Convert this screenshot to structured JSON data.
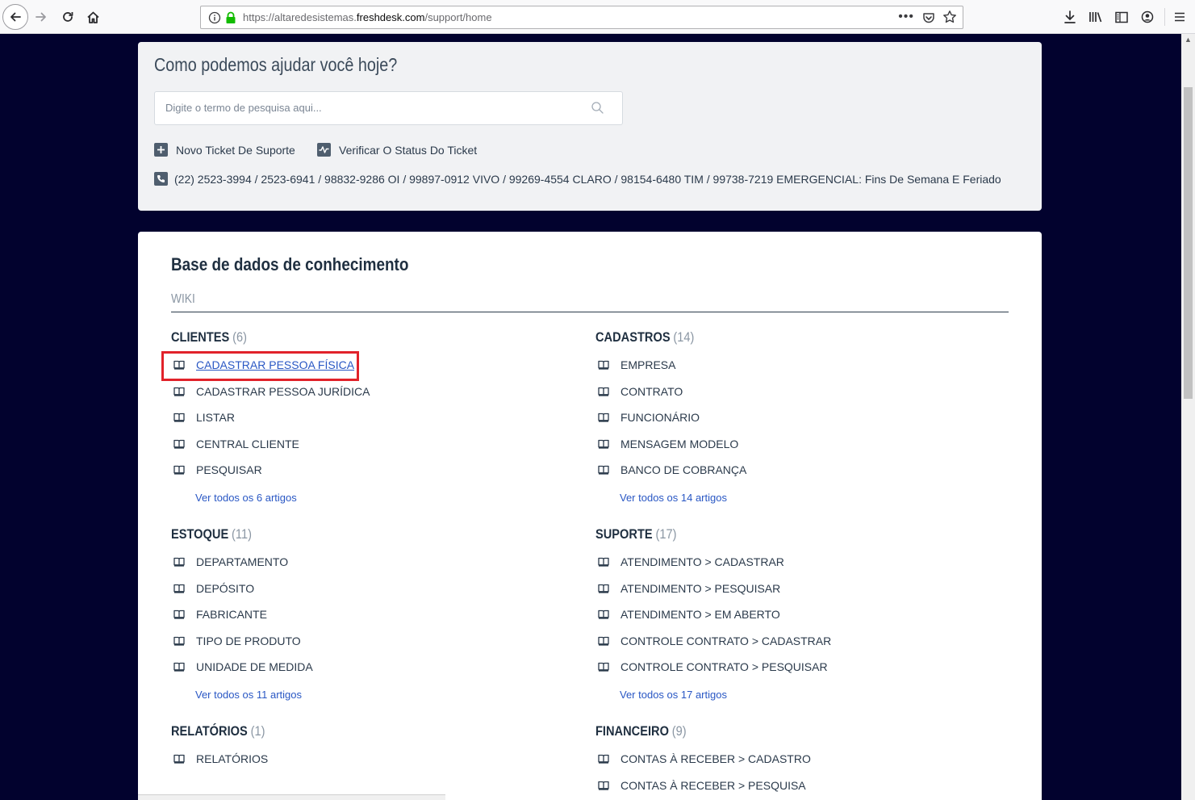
{
  "browser": {
    "url_prefix": "https://altaredesistemas.",
    "url_host": "freshdesk.com",
    "url_path": "/support/home",
    "more_label": "•••"
  },
  "search_card": {
    "title": "Como podemos ajudar você hoje?",
    "search_placeholder": "Digite o termo de pesquisa aqui...",
    "new_ticket_label": "Novo Ticket De Suporte",
    "check_status_label": "Verificar O Status Do Ticket",
    "phone_text": "(22) 2523-3994 / 2523-6941 / 98832-9286 OI / 99897-0912 VIVO / 99269-4554 CLARO / 98154-6480 TIM / 99738-7219 EMERGENCIAL: Fins De Semana E Feriado"
  },
  "knowledge_base": {
    "title": "Base de dados de conhecimento",
    "section": "WIKI",
    "categories": [
      {
        "name": "CLIENTES",
        "count": "(6)",
        "articles": [
          "CADASTRAR PESSOA FÍSICA",
          "CADASTRAR PESSOA JURÍDICA",
          "LISTAR",
          "CENTRAL CLIENTE",
          "PESQUISAR"
        ],
        "see_all": "Ver todos os 6 artigos"
      },
      {
        "name": "CADASTROS",
        "count": "(14)",
        "articles": [
          "EMPRESA",
          "CONTRATO",
          "FUNCIONÁRIO",
          "MENSAGEM MODELO",
          "BANCO DE COBRANÇA"
        ],
        "see_all": "Ver todos os 14 artigos"
      },
      {
        "name": "ESTOQUE",
        "count": "(11)",
        "articles": [
          "DEPARTAMENTO",
          "DEPÓSITO",
          "FABRICANTE",
          "TIPO DE PRODUTO",
          "UNIDADE DE MEDIDA"
        ],
        "see_all": "Ver todos os 11 artigos"
      },
      {
        "name": "SUPORTE",
        "count": "(17)",
        "articles": [
          "ATENDIMENTO > CADASTRAR",
          "ATENDIMENTO > PESQUISAR",
          "ATENDIMENTO > EM ABERTO",
          "CONTROLE CONTRATO > CADASTRAR",
          "CONTROLE CONTRATO > PESQUISAR"
        ],
        "see_all": "Ver todos os 17 artigos"
      },
      {
        "name": "RELATÓRIOS",
        "count": "(1)",
        "articles": [
          "RELATÓRIOS"
        ]
      },
      {
        "name": "FINANCEIRO",
        "count": "(9)",
        "articles": [
          "CONTAS À RECEBER > CADASTRO",
          "CONTAS À RECEBER > PESQUISA"
        ]
      }
    ]
  },
  "colors": {
    "page_bg": "#02022e",
    "link": "#2957c4",
    "highlight_box": "#e1222a"
  }
}
